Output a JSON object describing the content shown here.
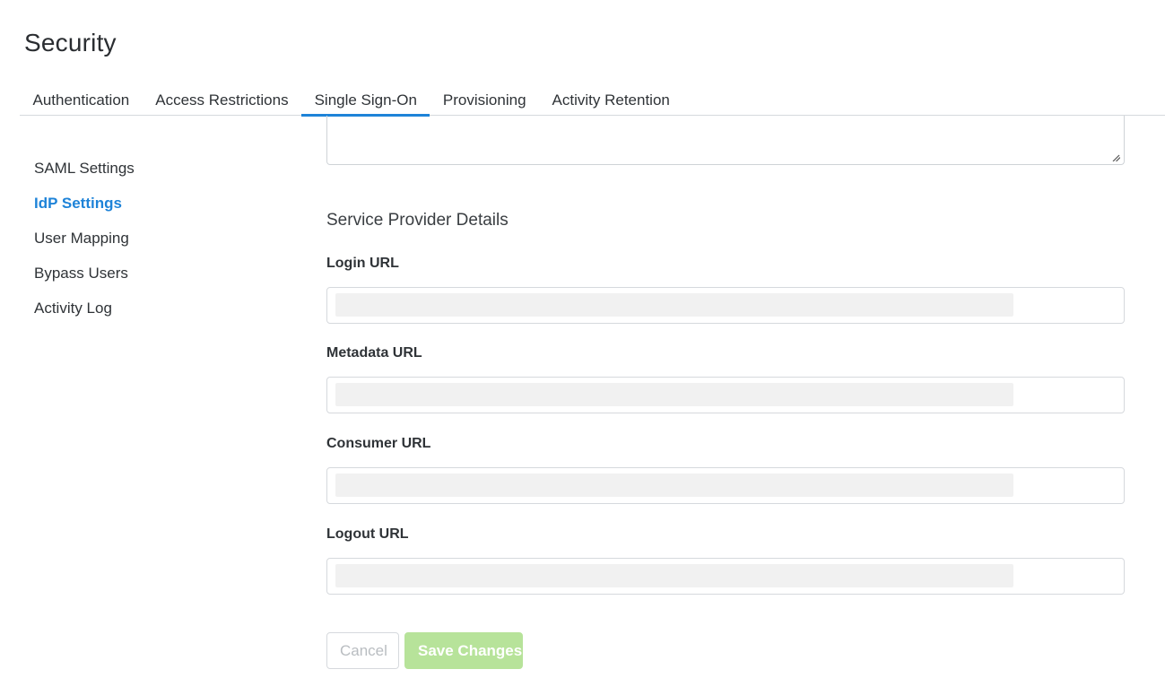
{
  "page": {
    "title": "Security"
  },
  "tabs": [
    {
      "label": "Authentication",
      "active": false
    },
    {
      "label": "Access Restrictions",
      "active": false
    },
    {
      "label": "Single Sign-On",
      "active": true
    },
    {
      "label": "Provisioning",
      "active": false
    },
    {
      "label": "Activity Retention",
      "active": false
    }
  ],
  "sidebar": {
    "items": [
      {
        "label": "SAML Settings",
        "active": false
      },
      {
        "label": "IdP Settings",
        "active": true
      },
      {
        "label": "User Mapping",
        "active": false
      },
      {
        "label": "Bypass Users",
        "active": false
      },
      {
        "label": "Activity Log",
        "active": false
      }
    ]
  },
  "main": {
    "section_title": "Service Provider Details",
    "fields": [
      {
        "label": "Login URL",
        "value": ""
      },
      {
        "label": "Metadata URL",
        "value": ""
      },
      {
        "label": "Consumer URL",
        "value": ""
      },
      {
        "label": "Logout URL",
        "value": ""
      }
    ]
  },
  "actions": {
    "cancel_label": "Cancel",
    "save_label": "Save Changes"
  },
  "colors": {
    "accent": "#1e83d8",
    "save_button_bg": "#b7e39a",
    "value_placeholder_bg": "#f1f1f1"
  },
  "icons": {
    "resize_handle": "resize-handle-icon"
  }
}
